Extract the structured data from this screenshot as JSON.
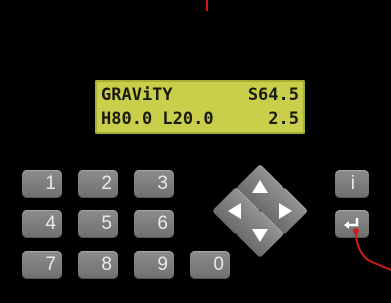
{
  "display": {
    "line1_left": "GRAViTY",
    "line1_right": "S64.5",
    "line2_left": "H80.0 L20.0",
    "line2_right": "2.5"
  },
  "keypad": {
    "keys": [
      "1",
      "2",
      "3",
      "4",
      "5",
      "6",
      "7",
      "8",
      "9",
      "0"
    ],
    "info_label": "i",
    "enter_glyph": "↵"
  },
  "colors": {
    "panel": "#000000",
    "lcd_background": "#c9cf4a",
    "key": "#7d7d7d",
    "key_text": "#e9e9e9",
    "annotation_line": "#d01a1a"
  },
  "icons": [
    "arrow-up-icon",
    "arrow-down-icon",
    "arrow-left-icon",
    "arrow-right-icon",
    "info-icon",
    "enter-icon"
  ]
}
